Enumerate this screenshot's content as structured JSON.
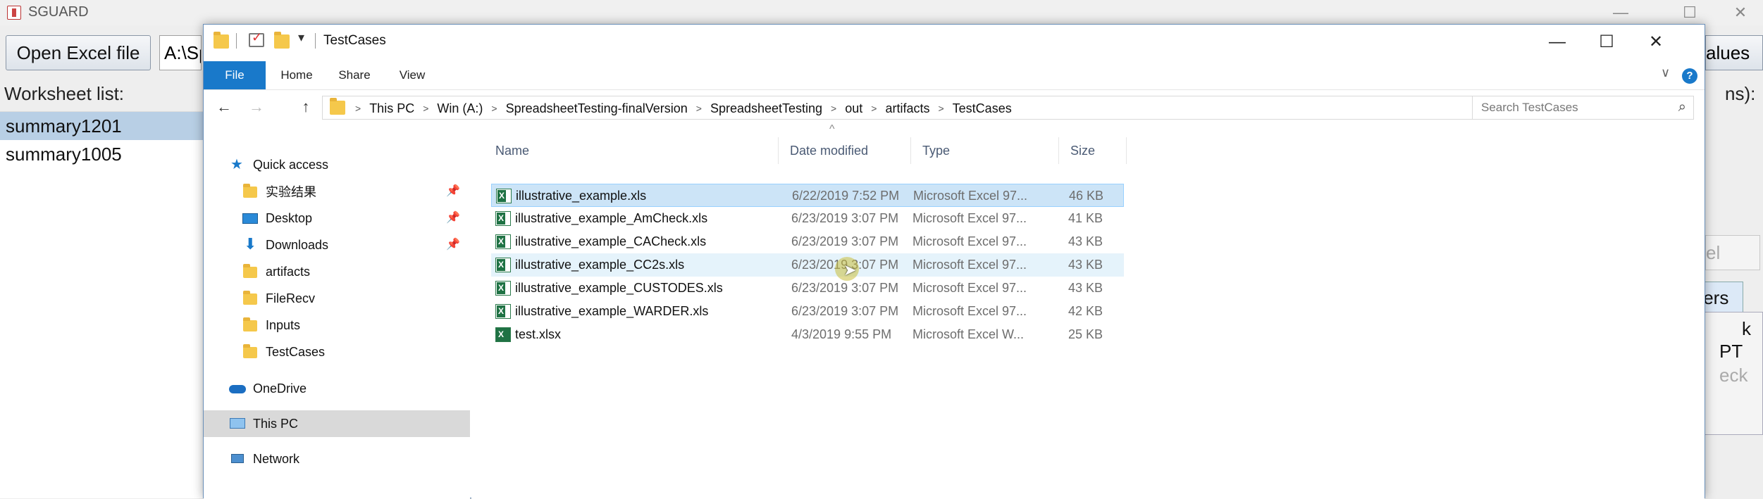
{
  "app": {
    "title": "SGUARD",
    "open_button": "Open Excel file",
    "path_value": "A:\\Sp",
    "worksheet_label": "Worksheet list:",
    "worksheets": [
      {
        "label": "summary1201",
        "selected": true
      },
      {
        "label": "summary1005",
        "selected": false
      }
    ],
    "right_button_fragment": "alues",
    "right_label_fragment": "ns):",
    "right_disabled_fragment": "el",
    "right_tab_fragment": "sters",
    "right_panel_lines": [
      "k",
      "PT",
      "eck"
    ],
    "window_controls": {
      "minimize": "—",
      "maximize": "☐",
      "close": "✕"
    }
  },
  "explorer": {
    "title": "TestCases",
    "quick_access_dropdown": "▾",
    "window_controls": {
      "minimize": "—",
      "maximize": "☐",
      "close": "✕"
    },
    "ribbon_tabs": [
      "File",
      "Home",
      "Share",
      "View"
    ],
    "ribbon_expand": "∨",
    "help": "?",
    "nav": {
      "back": "←",
      "forward": "→",
      "up": "↑"
    },
    "breadcrumbs": [
      "This PC",
      "Win (A:)",
      "SpreadsheetTesting-finalVersion",
      "SpreadsheetTesting",
      "out",
      "artifacts",
      "TestCases"
    ],
    "breadcrumb_sep": ">",
    "address_dropdown": "∨",
    "refresh": "↻",
    "search_placeholder": "Search TestCases",
    "search_icon": "⌕",
    "navpane": {
      "quick_access": "Quick access",
      "pinned": [
        {
          "label": "实验结果",
          "icon": "folder-icon",
          "pinned": true
        },
        {
          "label": "Desktop",
          "icon": "desktop-icon",
          "pinned": true
        },
        {
          "label": "Downloads",
          "icon": "downloads-icon",
          "pinned": true
        }
      ],
      "folders": [
        "artifacts",
        "FileRecv",
        "Inputs",
        "TestCases"
      ],
      "onedrive": "OneDrive",
      "this_pc": "This PC",
      "network": "Network",
      "pin_glyph": "📌"
    },
    "columns": {
      "name": "Name",
      "date": "Date modified",
      "type": "Type",
      "size": "Size",
      "sort_caret": "^"
    },
    "files": [
      {
        "name": "illustrative_example.xls",
        "date": "6/22/2019 7:52 PM",
        "type": "Microsoft Excel 97...",
        "size": "46 KB"
      },
      {
        "name": "illustrative_example_AmCheck.xls",
        "date": "6/23/2019 3:07 PM",
        "type": "Microsoft Excel 97...",
        "size": "41 KB"
      },
      {
        "name": "illustrative_example_CACheck.xls",
        "date": "6/23/2019 3:07 PM",
        "type": "Microsoft Excel 97...",
        "size": "43 KB"
      },
      {
        "name": "illustrative_example_CC2s.xls",
        "date": "6/23/2019 3:07 PM",
        "type": "Microsoft Excel 97...",
        "size": "43 KB"
      },
      {
        "name": "illustrative_example_CUSTODES.xls",
        "date": "6/23/2019 3:07 PM",
        "type": "Microsoft Excel 97...",
        "size": "43 KB"
      },
      {
        "name": "illustrative_example_WARDER.xls",
        "date": "6/23/2019 3:07 PM",
        "type": "Microsoft Excel 97...",
        "size": "42 KB"
      },
      {
        "name": "test.xlsx",
        "date": "4/3/2019 9:55 PM",
        "type": "Microsoft Excel W...",
        "size": "25 KB"
      }
    ],
    "cursor_arrow": "➤",
    "colors": {
      "accent": "#1979ca",
      "selection": "#cce4f7",
      "hover": "#e5f3fb",
      "folder": "#f5c84b",
      "excel": "#1f7244"
    }
  }
}
